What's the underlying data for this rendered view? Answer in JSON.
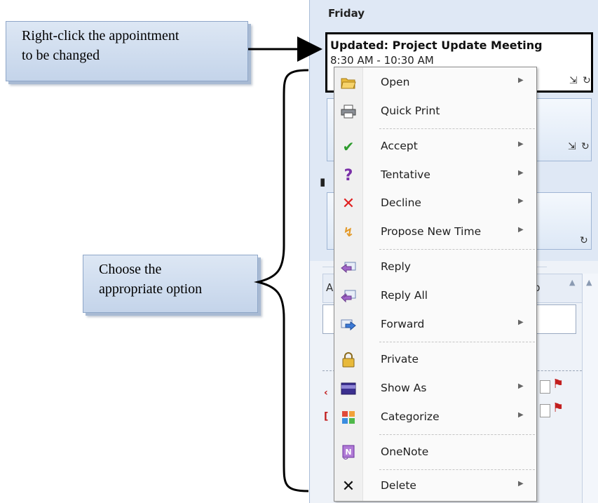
{
  "callouts": {
    "top": [
      "Right-click the appointment",
      "to be changed"
    ],
    "middle": [
      "Choose the",
      "appropriate option"
    ]
  },
  "calendar": {
    "day": "Friday",
    "selected_appointment": {
      "title": "Updated: Project Update Meeting",
      "time": "8:30 AM - 10:30 AM"
    },
    "partial_letters": [
      "A",
      "p"
    ]
  },
  "context_menu": {
    "items": [
      {
        "label": "Open",
        "icon": "open-folder-icon",
        "submenu": true
      },
      {
        "label": "Quick Print",
        "icon": "printer-icon",
        "submenu": false
      },
      {
        "label": "Accept",
        "icon": "checkmark-icon",
        "submenu": true
      },
      {
        "label": "Tentative",
        "icon": "question-mark-icon",
        "submenu": true
      },
      {
        "label": "Decline",
        "icon": "red-x-icon",
        "submenu": true
      },
      {
        "label": "Propose New Time",
        "icon": "propose-time-icon",
        "submenu": true
      },
      {
        "label": "Reply",
        "icon": "reply-icon",
        "submenu": false
      },
      {
        "label": "Reply All",
        "icon": "reply-all-icon",
        "submenu": false
      },
      {
        "label": "Forward",
        "icon": "forward-icon",
        "submenu": true
      },
      {
        "label": "Private",
        "icon": "lock-icon",
        "submenu": false
      },
      {
        "label": "Show As",
        "icon": "show-as-icon",
        "submenu": true
      },
      {
        "label": "Categorize",
        "icon": "categorize-icon",
        "submenu": true
      },
      {
        "label": "OneNote",
        "icon": "onenote-icon",
        "submenu": false
      },
      {
        "label": "Delete",
        "icon": "delete-x-icon",
        "submenu": true
      }
    ]
  },
  "colors": {
    "callout": "#c4d4ea",
    "accept": "#2e9b2e",
    "tentative": "#7a2fa8",
    "decline": "#e02020",
    "flag": "#c21f1f"
  }
}
